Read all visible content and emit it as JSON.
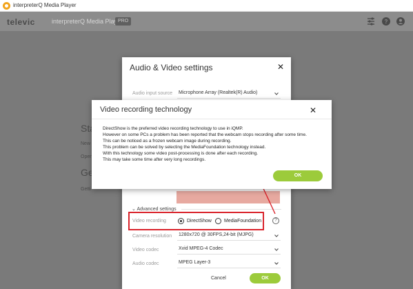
{
  "window": {
    "title": "interpreterQ Media Player"
  },
  "header": {
    "logo": "televic",
    "app_name": "interpreterQ Media Player",
    "badge": "PRO"
  },
  "background": {
    "heading1": "Sta",
    "line1": "New p",
    "line2": "Open",
    "heading2": "Ge",
    "line3": "Getti"
  },
  "av_dialog": {
    "title": "Audio & Video settings",
    "audio_input_label": "Audio input source",
    "audio_input_value": "Microphone Array (Realtek(R) Audio)",
    "advanced_label": "Advanced settings",
    "video_recording_label": "Video recording",
    "option_directshow": "DirectShow",
    "option_mediafoundation": "MediaFoundation",
    "selected_option": "DirectShow",
    "help_glyph": "?",
    "camera_resolution_label": "Camera resolution",
    "camera_resolution_value": "1280x720 @ 30FPS,24-bit (MJPG)",
    "video_codec_label": "Video codec",
    "video_codec_value": "Xvid MPEG-4 Codec",
    "audio_codec_label": "Audio codec",
    "audio_codec_value": "MPEG Layer-3",
    "cancel_label": "Cancel",
    "ok_label": "OK"
  },
  "vrt_dialog": {
    "title": "Video recording technology",
    "lines": [
      "DirectShow is the preferred video recording technology to use in iQMP.",
      "However on some PCs a problem has been reported that the webcam stops recording after some time.",
      "This can be noticed as a frozen webcam image during recording.",
      "This problem can be solved by selecting the MediaFoundation technology instead.",
      "With this technology some video post-processing is done after each recording.",
      "This may take some time after very long recordings."
    ],
    "ok_label": "OK"
  },
  "colors": {
    "accent_green": "#9ccb3b",
    "highlight_red": "#d9222a",
    "header_gray": "#8c8c8c"
  },
  "icons": [
    "app-icon",
    "sliders-icon",
    "help-icon",
    "user-icon",
    "close-icon",
    "chevron-down-icon"
  ]
}
